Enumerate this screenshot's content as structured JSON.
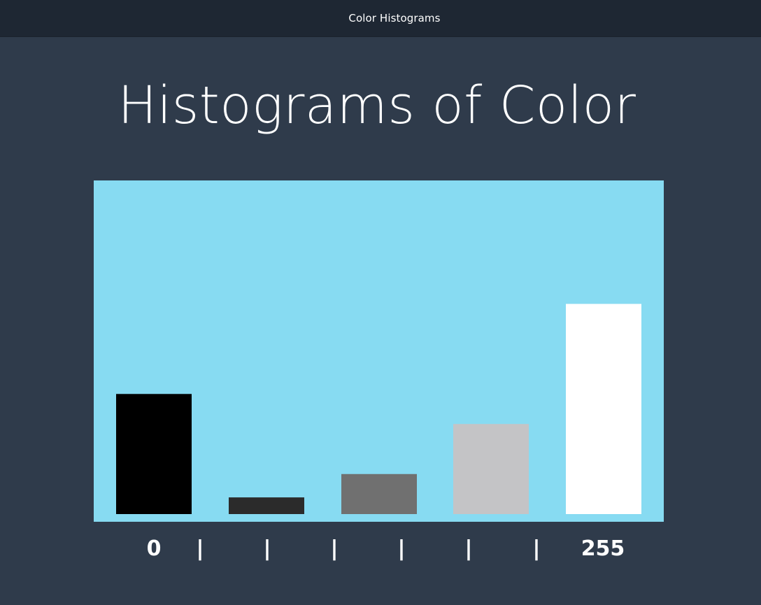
{
  "window": {
    "title": "Color Histograms"
  },
  "slide": {
    "title": "Histograms of Color"
  },
  "chart_data": {
    "type": "bar",
    "title": "",
    "xlabel": "",
    "ylabel": "",
    "categories": [
      "0",
      "",
      "",
      "",
      "255"
    ],
    "values": [
      36,
      5,
      12,
      27,
      63
    ],
    "bar_colors": [
      "#000000",
      "#2b2b2b",
      "#707070",
      "#c4c4c6",
      "#ffffff"
    ],
    "tick_labels": [
      "0",
      "|",
      "|",
      "|",
      "|",
      "|",
      "255"
    ],
    "background_color": "#87dbf2",
    "ylim": [
      0,
      100
    ],
    "grid": false,
    "legend": "none"
  },
  "colors": {
    "page_background": "#2f3b4b",
    "title_bar": "#1e2733",
    "text": "#ffffff"
  }
}
